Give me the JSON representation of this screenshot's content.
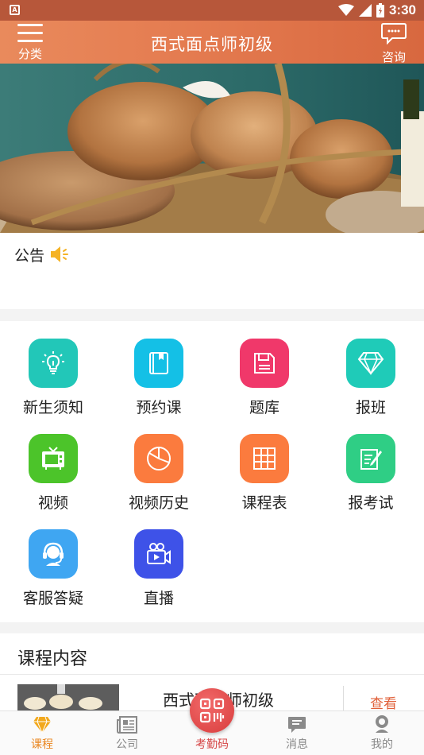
{
  "status_bar": {
    "time": "3:30",
    "left_icon": "A"
  },
  "header": {
    "title": "西式面点师初级",
    "menu_label": "分类",
    "consult_label": "咨询"
  },
  "notice": {
    "label": "公告"
  },
  "grid": {
    "items": [
      {
        "label": "新生须知",
        "icon": "lightbulb-icon",
        "color": "#22c7b8"
      },
      {
        "label": "预约课",
        "icon": "book-icon",
        "color": "#14c0e6"
      },
      {
        "label": "题库",
        "icon": "save-disk-icon",
        "color": "#f0386a"
      },
      {
        "label": "报班",
        "icon": "diamond-icon",
        "color": "#1fcbb8"
      },
      {
        "label": "视频",
        "icon": "tv-icon",
        "color": "#4cc42a"
      },
      {
        "label": "视频历史",
        "icon": "pie-chart-icon",
        "color": "#fb7b3e"
      },
      {
        "label": "课程表",
        "icon": "table-grid-icon",
        "color": "#fb7b3e"
      },
      {
        "label": "报考试",
        "icon": "edit-document-icon",
        "color": "#2fce85"
      },
      {
        "label": "客服答疑",
        "icon": "customer-service-icon",
        "color": "#3fa6f2"
      },
      {
        "label": "直播",
        "icon": "video-camera-icon",
        "color": "#3e52e8"
      }
    ]
  },
  "course_section": {
    "title": "课程内容",
    "item": {
      "name": "西式面点师初级",
      "action": "查看"
    }
  },
  "tab_bar": {
    "items": [
      {
        "label": "课程",
        "icon": "diamond-icon",
        "active": true
      },
      {
        "label": "公司",
        "icon": "newspaper-icon",
        "active": false
      },
      {
        "label": "考勤码",
        "icon": "qr-code-icon",
        "active": false
      },
      {
        "label": "消息",
        "icon": "message-icon",
        "active": false
      },
      {
        "label": "我的",
        "icon": "user-icon",
        "active": false
      }
    ],
    "active_color": "#e9861f",
    "center_color": "#d64747"
  }
}
